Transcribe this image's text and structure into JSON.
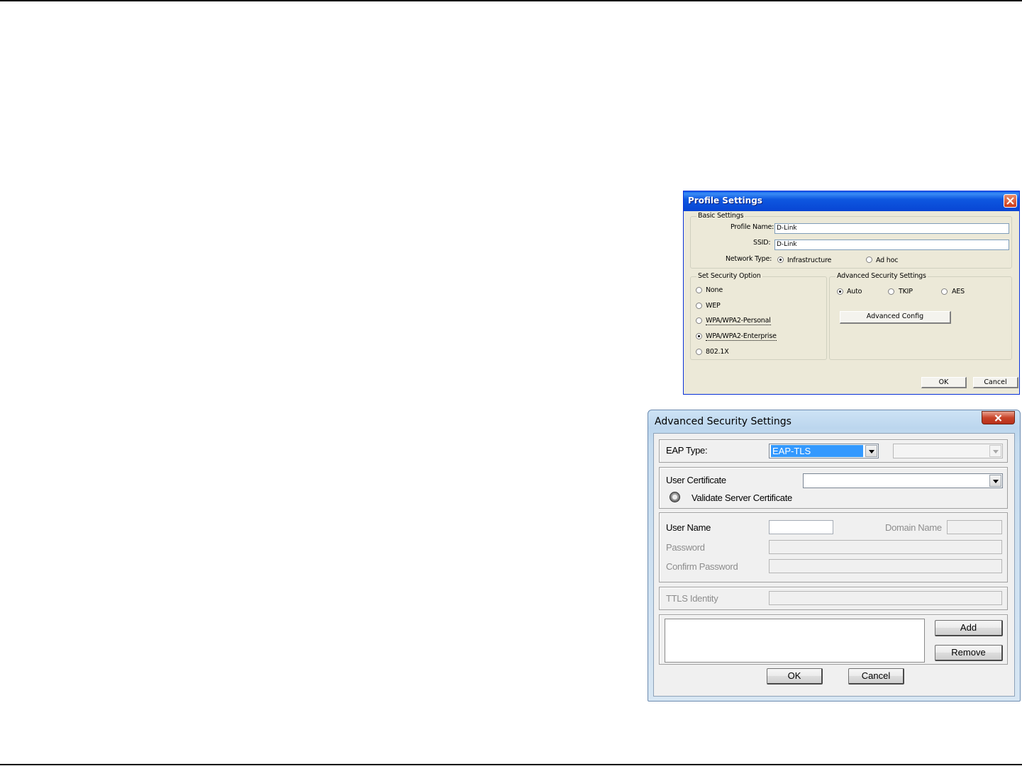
{
  "profile_dialog": {
    "title": "Profile Settings",
    "basic_settings": {
      "legend": "Basic Settings",
      "profile_name_label": "Profile Name:",
      "profile_name_value": "D-Link",
      "ssid_label": "SSID:",
      "ssid_value": "D-Link",
      "network_type_label": "Network Type:",
      "network_types": [
        "Infrastructure",
        "Ad hoc"
      ],
      "selected_network_type": "Infrastructure"
    },
    "security_option": {
      "legend": "Set Security Option",
      "options": [
        "None",
        "WEP",
        "WPA/WPA2-Personal",
        "WPA/WPA2-Enterprise",
        "802.1X"
      ],
      "selected": "WPA/WPA2-Enterprise"
    },
    "advanced_security": {
      "legend": "Advanced Security Settings",
      "options": [
        "Auto",
        "TKIP",
        "AES"
      ],
      "selected": "Auto",
      "config_button": "Advanced Config"
    },
    "ok_label": "OK",
    "cancel_label": "Cancel"
  },
  "advanced_dialog": {
    "title": "Advanced Security Settings",
    "eap_type_label": "EAP Type:",
    "eap_type_value": "EAP-TLS",
    "eap_secondary_value": "",
    "user_certificate_label": "User Certificate",
    "user_certificate_value": "",
    "validate_server_label": "Validate Server Certificate",
    "user_name_label": "User Name",
    "user_name_value": "",
    "domain_name_label": "Domain Name",
    "domain_name_value": "",
    "password_label": "Password",
    "confirm_password_label": "Confirm Password",
    "ttls_identity_label": "TTLS Identity",
    "add_label": "Add",
    "remove_label": "Remove",
    "ok_label": "OK",
    "cancel_label": "Cancel"
  },
  "colors": {
    "xp_titlebar": "#0a5ce9",
    "xp_face": "#ece9d8",
    "vista_face": "#f0f0f0",
    "selection": "#3399ff",
    "close_red": "#c8442a"
  }
}
